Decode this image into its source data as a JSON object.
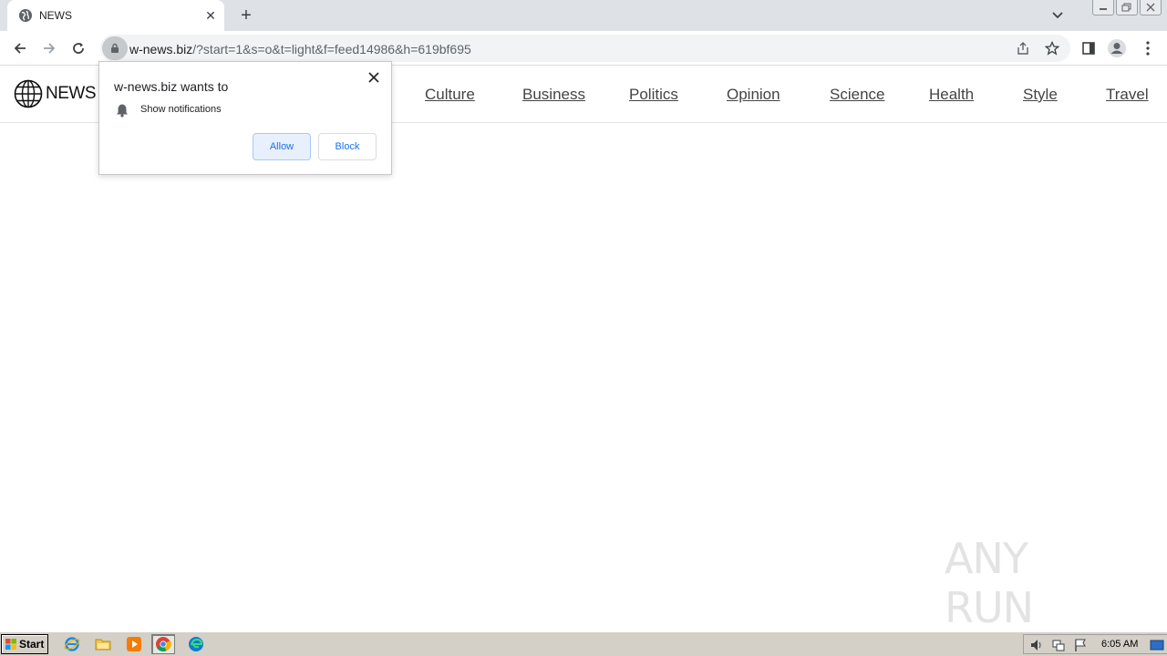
{
  "browser": {
    "tab": {
      "title": "NEWS",
      "close": "✕"
    },
    "new_tab": "+",
    "url": {
      "host": "w-news.biz",
      "path": "/?start=1&s=o&t=light&f=feed14986&h=619bf695"
    }
  },
  "site": {
    "logo_text": "NEWS",
    "nav": [
      "Culture",
      "Business",
      "Politics",
      "Opinion",
      "Science",
      "Health",
      "Style",
      "Travel"
    ]
  },
  "popup": {
    "title": "w-news.biz wants to",
    "permission": "Show notifications",
    "allow_label": "Allow",
    "block_label": "Block"
  },
  "watermark": "ANY RUN",
  "taskbar": {
    "start_label": "Start",
    "time": "6:05 AM"
  },
  "colors": {
    "tabstrip": "#dee1e6",
    "accent": "#1a73e8",
    "taskbar": "#d4d0c8"
  }
}
